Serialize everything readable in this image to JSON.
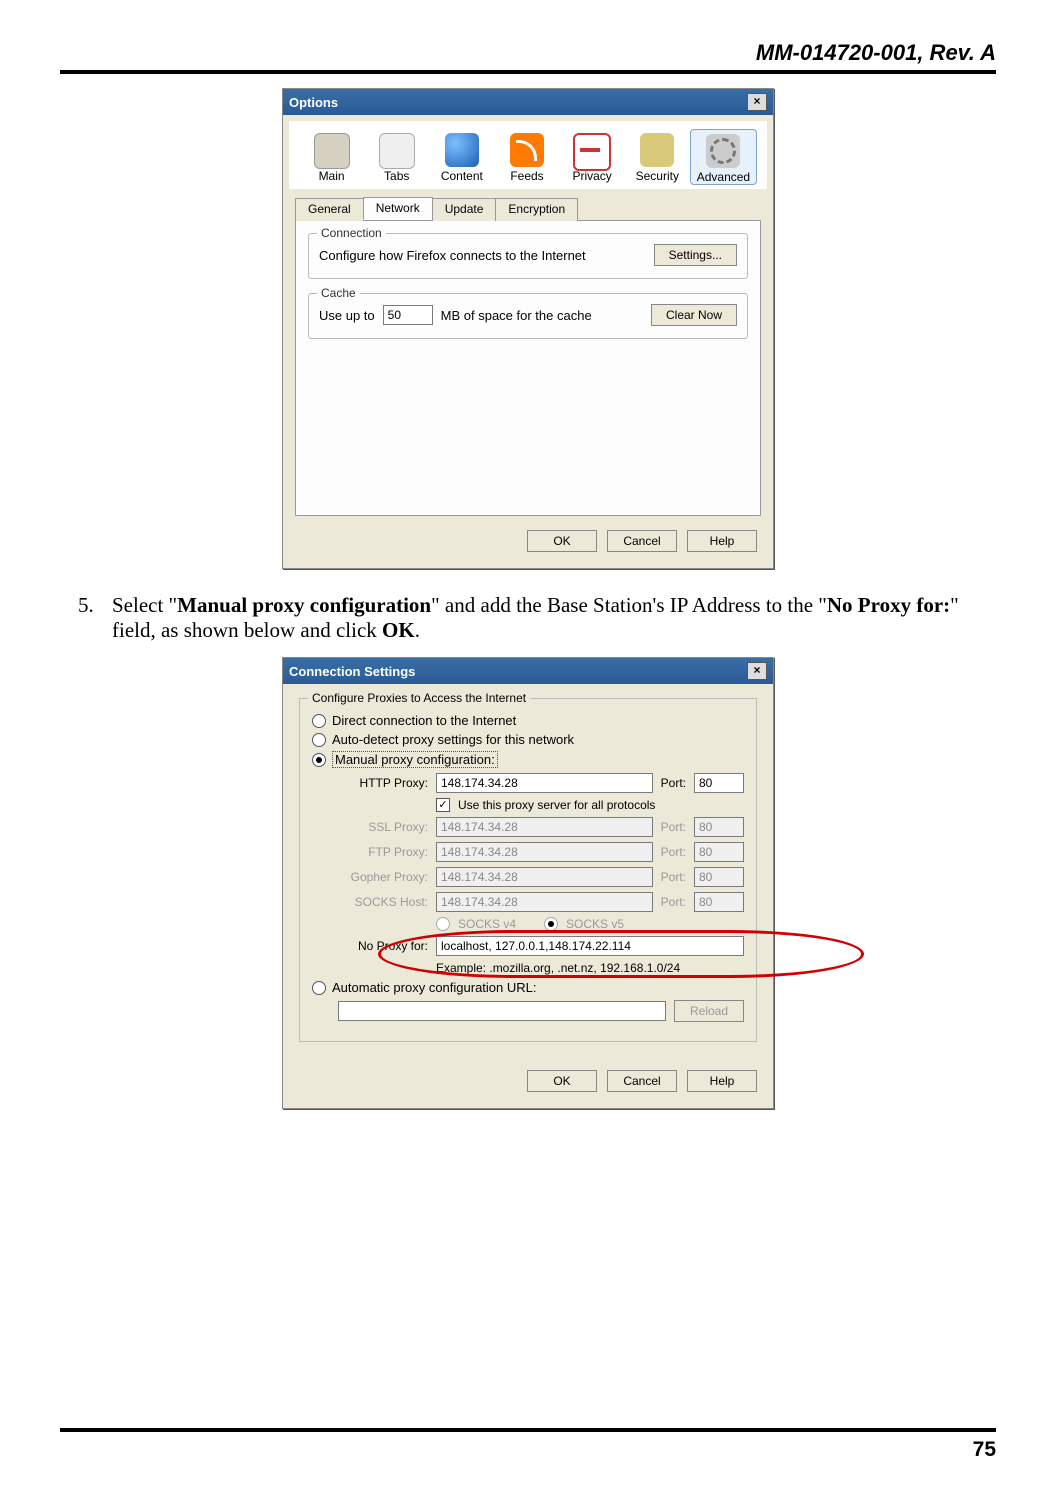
{
  "header": "MM-014720-001, Rev. A",
  "page_number": "75",
  "step": {
    "num": "5.",
    "pre": "Select \"",
    "bold1": "Manual proxy configuration",
    "mid": "\" and add the Base Station's IP Address to the \"",
    "bold2": "No Proxy for:",
    "post1": "\" field, as shown below and click ",
    "bold3": "OK",
    "post2": "."
  },
  "dlg1": {
    "title": "Options",
    "cats": [
      "Main",
      "Tabs",
      "Content",
      "Feeds",
      "Privacy",
      "Security",
      "Advanced"
    ],
    "cat_selected": 6,
    "tabs": [
      "General",
      "Network",
      "Update",
      "Encryption"
    ],
    "tab_selected": 1,
    "conn": {
      "legend": "Connection",
      "text": "Configure how Firefox connects to the Internet",
      "btn": "Settings..."
    },
    "cache": {
      "legend": "Cache",
      "use_up_to": "Use up to",
      "value": "50",
      "suffix": "MB of space for the cache",
      "btn": "Clear Now"
    },
    "ok": "OK",
    "cancel": "Cancel",
    "help": "Help"
  },
  "dlg2": {
    "title": "Connection Settings",
    "legend": "Configure Proxies to Access the Internet",
    "opt_direct": "Direct connection to the Internet",
    "opt_auto": "Auto-detect proxy settings for this network",
    "opt_manual": "Manual proxy configuration:",
    "http_l": "HTTP Proxy:",
    "http_v": "148.174.34.28",
    "http_p": "80",
    "use_all": "Use this proxy server for all protocols",
    "ssl_l": "SSL Proxy:",
    "ssl_v": "148.174.34.28",
    "ssl_p": "80",
    "ftp_l": "FTP Proxy:",
    "ftp_v": "148.174.34.28",
    "ftp_p": "80",
    "gop_l": "Gopher Proxy:",
    "gop_v": "148.174.34.28",
    "gop_p": "80",
    "sck_l": "SOCKS Host:",
    "sck_v": "148.174.34.28",
    "sck_p": "80",
    "port_l": "Port:",
    "socks4": "SOCKS v4",
    "socks5": "SOCKS v5",
    "nop_l": "No Proxy for:",
    "nop_v": "localhost, 127.0.0.1,148.174.22.114",
    "nop_ex": "Example: .mozilla.org, .net.nz, 192.168.1.0/24",
    "opt_pac": "Automatic proxy configuration URL:",
    "reload": "Reload",
    "ok": "OK",
    "cancel": "Cancel",
    "help": "Help"
  }
}
